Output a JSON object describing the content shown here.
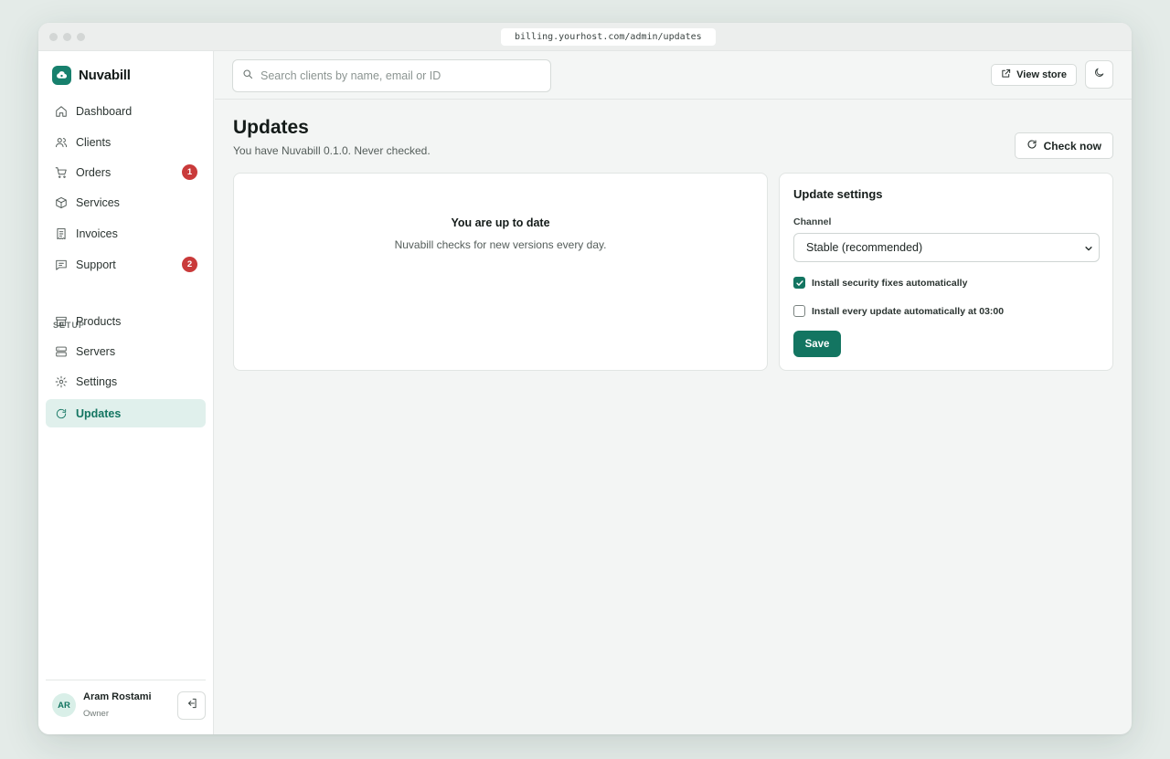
{
  "browser": {
    "url": "billing.yourhost.com/admin/updates"
  },
  "brand": {
    "name": "Nuvabill",
    "icon": "cloud-logo-icon"
  },
  "sidebar": {
    "items": [
      {
        "label": "Dashboard",
        "icon": "home-icon"
      },
      {
        "label": "Clients",
        "icon": "users-icon"
      },
      {
        "label": "Orders",
        "icon": "cart-icon",
        "badge": "1"
      },
      {
        "label": "Services",
        "icon": "box-icon"
      },
      {
        "label": "Invoices",
        "icon": "receipt-icon"
      },
      {
        "label": "Support",
        "icon": "message-icon",
        "badge": "2"
      }
    ],
    "section_label": "SETUP",
    "setup_items": [
      {
        "label": "Products",
        "icon": "store-icon"
      },
      {
        "label": "Servers",
        "icon": "server-icon"
      },
      {
        "label": "Settings",
        "icon": "gear-icon"
      },
      {
        "label": "Updates",
        "icon": "refresh-icon",
        "active": true
      }
    ],
    "user": {
      "initials": "AR",
      "name": "Aram Rostami",
      "role": "Owner"
    }
  },
  "topbar": {
    "search_placeholder": "Search clients by name, email or ID",
    "view_store_label": "View store"
  },
  "page": {
    "title": "Updates",
    "subtitle": "You have Nuvabill 0.1.0. Never checked.",
    "check_now_label": "Check now"
  },
  "status_card": {
    "title": "You are up to date",
    "text": "Nuvabill checks for new versions every day."
  },
  "settings_card": {
    "title": "Update settings",
    "channel_label": "Channel",
    "channel_value": "Stable (recommended)",
    "security_label": "Install security fixes automatically",
    "security_checked": true,
    "auto_label": "Install every update automatically at 03:00",
    "auto_checked": false,
    "save_label": "Save"
  },
  "colors": {
    "accent": "#137561",
    "badge": "#c93a3a",
    "active_bg": "#e0f0ec"
  }
}
